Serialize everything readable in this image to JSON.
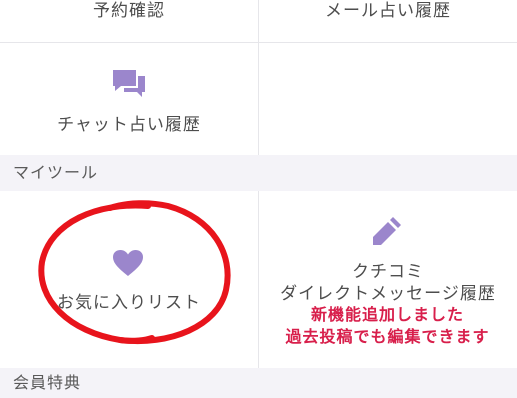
{
  "menu_top": {
    "reservation_label": "予約確認",
    "mail_history_label": "メール占い履歴",
    "chat_history_label": "チャット占い履歴"
  },
  "my_tools": {
    "section_title": "マイツール",
    "favorites_label": "お気に入りリスト",
    "review_label": "クチコミ",
    "dm_history_label": "ダイレクトメッセージ履歴",
    "notice_line1": "新機能追加しました",
    "notice_line2": "過去投稿でも編集できます"
  },
  "member_benefits": {
    "section_title": "会員特典"
  },
  "colors": {
    "icon": "#9b86cc",
    "notice": "#d81f4b",
    "annotation": "#e8141c",
    "section_bg": "#f4f3f8"
  },
  "icons": {
    "chat": "chat-bubbles-icon",
    "favorites": "heart-icon",
    "review": "pencil-icon"
  }
}
